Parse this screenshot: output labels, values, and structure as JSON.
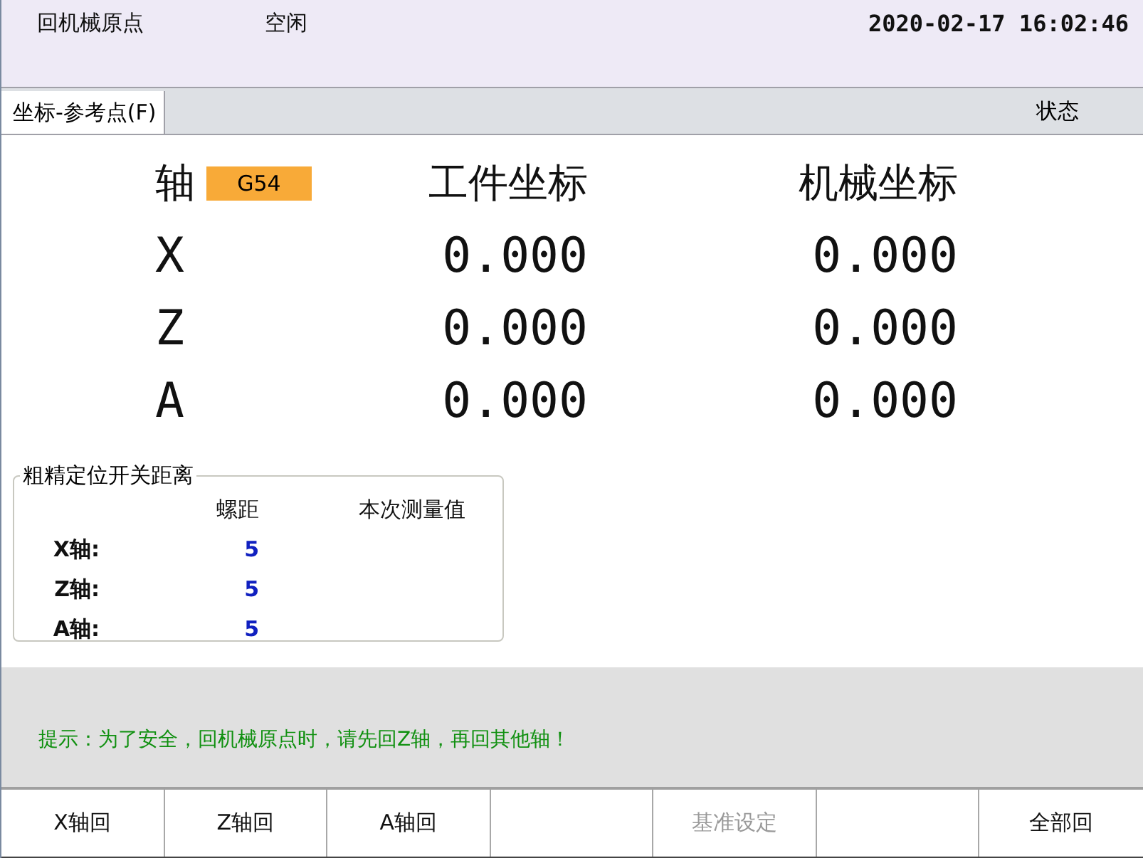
{
  "header": {
    "mode": "回机械原点",
    "state": "空闲",
    "datetime": "2020-02-17 16:02:46"
  },
  "tabs": [
    {
      "label": "坐标-参考点(F)",
      "selected": true
    }
  ],
  "status_label": "状态",
  "coords": {
    "axis_heading": "轴",
    "work_system": "G54",
    "work_heading": "工件坐标",
    "machine_heading": "机械坐标",
    "rows": [
      {
        "axis": "X",
        "work": "0.000",
        "machine": "0.000"
      },
      {
        "axis": "Z",
        "work": "0.000",
        "machine": "0.000"
      },
      {
        "axis": "A",
        "work": "0.000",
        "machine": "0.000"
      }
    ]
  },
  "switch_distance": {
    "title": "粗精定位开关距离",
    "columns": [
      "螺距",
      "本次测量值"
    ],
    "rows": [
      {
        "axis": "X轴:",
        "pitch": "5"
      },
      {
        "axis": "Z轴:",
        "pitch": "5"
      },
      {
        "axis": "A轴:",
        "pitch": "5"
      }
    ]
  },
  "hint": "提示：为了安全，回机械原点时，请先回Z轴，再回其他轴！",
  "softkeys": [
    {
      "kind": "key",
      "label": "X轴回",
      "disabled": false
    },
    {
      "kind": "key",
      "label": "Z轴回",
      "disabled": false
    },
    {
      "kind": "key",
      "label": "A轴回",
      "disabled": false
    },
    {
      "kind": "blank"
    },
    {
      "kind": "key",
      "label": "基准设定",
      "disabled": true
    },
    {
      "kind": "blank"
    },
    {
      "kind": "key",
      "label": "全部回",
      "disabled": false
    }
  ]
}
